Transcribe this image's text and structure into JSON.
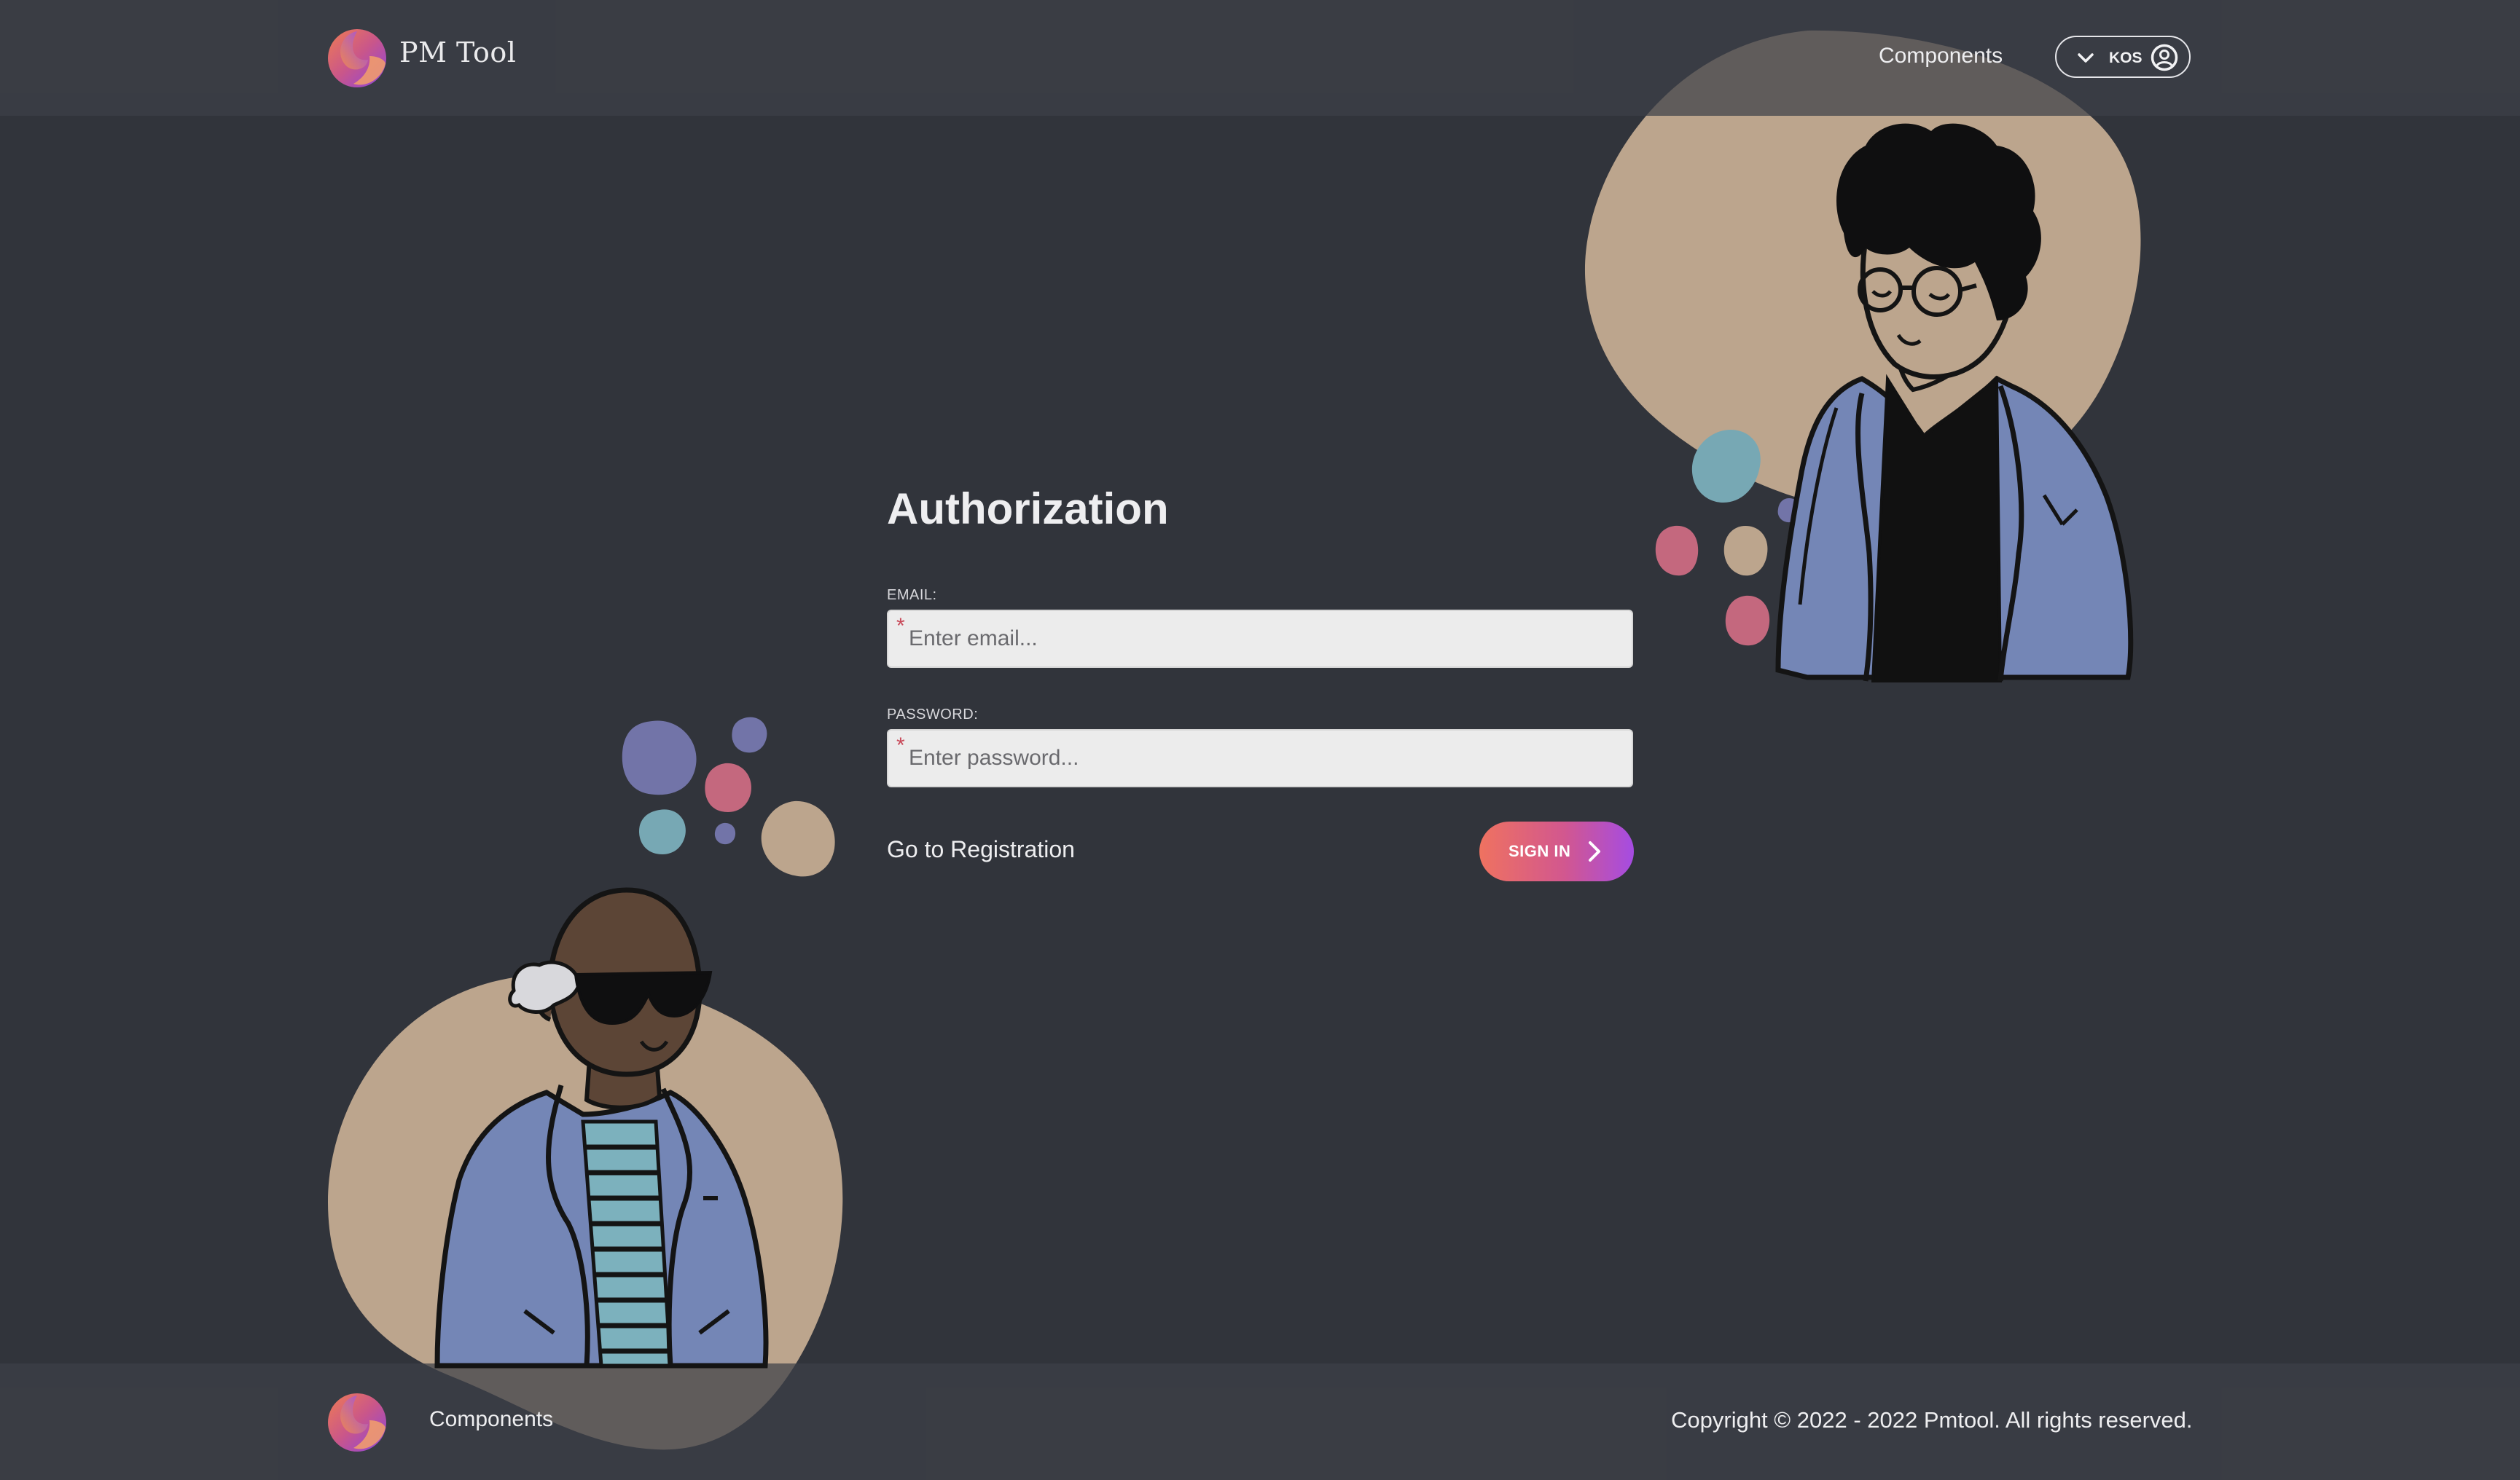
{
  "header": {
    "brand": "PM Tool",
    "nav_components": "Components",
    "user_label": "KOS"
  },
  "form": {
    "title": "Authorization",
    "email": {
      "label": "EMAIL:",
      "placeholder": "Enter email...",
      "required_mark": "*"
    },
    "password": {
      "label": "PASSWORD:",
      "placeholder": "Enter password...",
      "required_mark": "*"
    },
    "registration_link": "Go to Registration",
    "submit_label": "SIGN IN"
  },
  "footer": {
    "nav_components": "Components",
    "copyright": "Copyright © 2022 - 2022 Pmtool. All rights reserved."
  },
  "colors": {
    "background": "#31343b",
    "header_footer": "#3d4048",
    "accent_gradient_start": "#ef7260",
    "accent_gradient_end": "#a54ce2",
    "blob_beige": "#bca58d",
    "jacket_blue": "#7486b6",
    "required_red": "#c84858"
  },
  "icons": [
    "logo-icon",
    "chevron-down-icon",
    "user-circle-icon",
    "chevron-right-icon"
  ]
}
